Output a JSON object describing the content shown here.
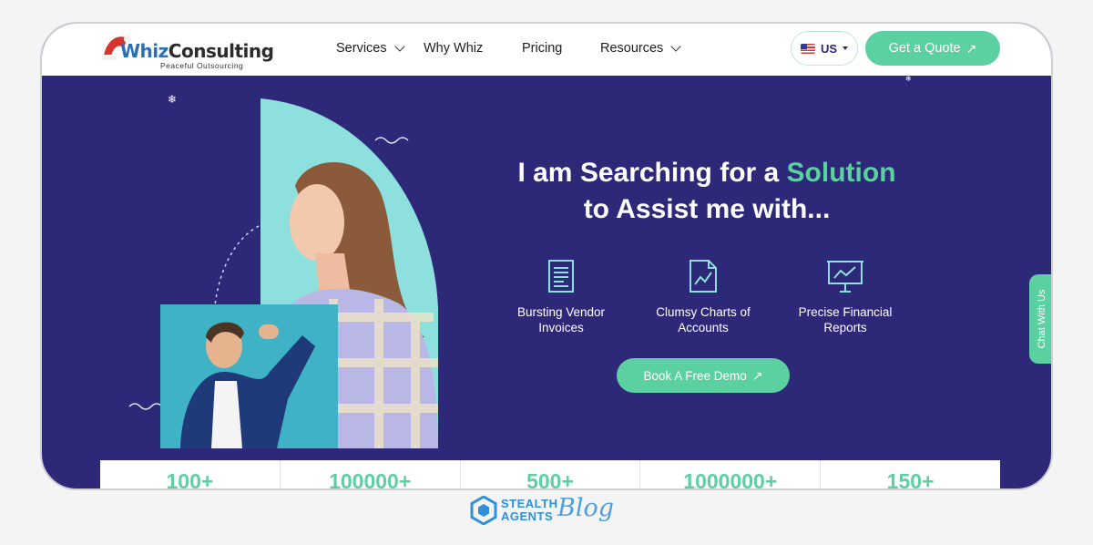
{
  "nav": {
    "logo": {
      "brand_prefix": "Whiz",
      "brand_suffix": "Consulting",
      "tagline": "Peaceful Outsourcing"
    },
    "menu": [
      {
        "label": "Services",
        "has_dropdown": true
      },
      {
        "label": "Why Whiz",
        "has_dropdown": false
      },
      {
        "label": "Pricing",
        "has_dropdown": false
      },
      {
        "label": "Resources",
        "has_dropdown": true
      }
    ],
    "region": {
      "label": "US",
      "icon": "us-flag-icon"
    },
    "cta_label": "Get a Quote"
  },
  "hero": {
    "title_line1_prefix": "I am Searching for a ",
    "title_line1_accent": "Solution",
    "title_line2": "to Assist me with...",
    "features": [
      {
        "label_line1": "Bursting Vendor",
        "label_line2": "Invoices",
        "icon": "invoice-icon"
      },
      {
        "label_line1": "Clumsy Charts of",
        "label_line2": "Accounts",
        "icon": "chart-document-icon"
      },
      {
        "label_line1": "Precise Financial",
        "label_line2": "Reports",
        "icon": "presentation-board-icon"
      }
    ],
    "demo_button_label": "Book A Free Demo"
  },
  "chat_tab_label": "Chat With Us",
  "stats": [
    "100+",
    "100000+",
    "500+",
    "1000000+",
    "150+"
  ],
  "footer_brand": {
    "line1": "STEALTH",
    "line2": "AGENTS",
    "script": "Blog"
  },
  "colors": {
    "navy": "#2e2878",
    "accent": "#5bd0a1",
    "teal_shape": "#8ee0df",
    "white": "#ffffff"
  }
}
